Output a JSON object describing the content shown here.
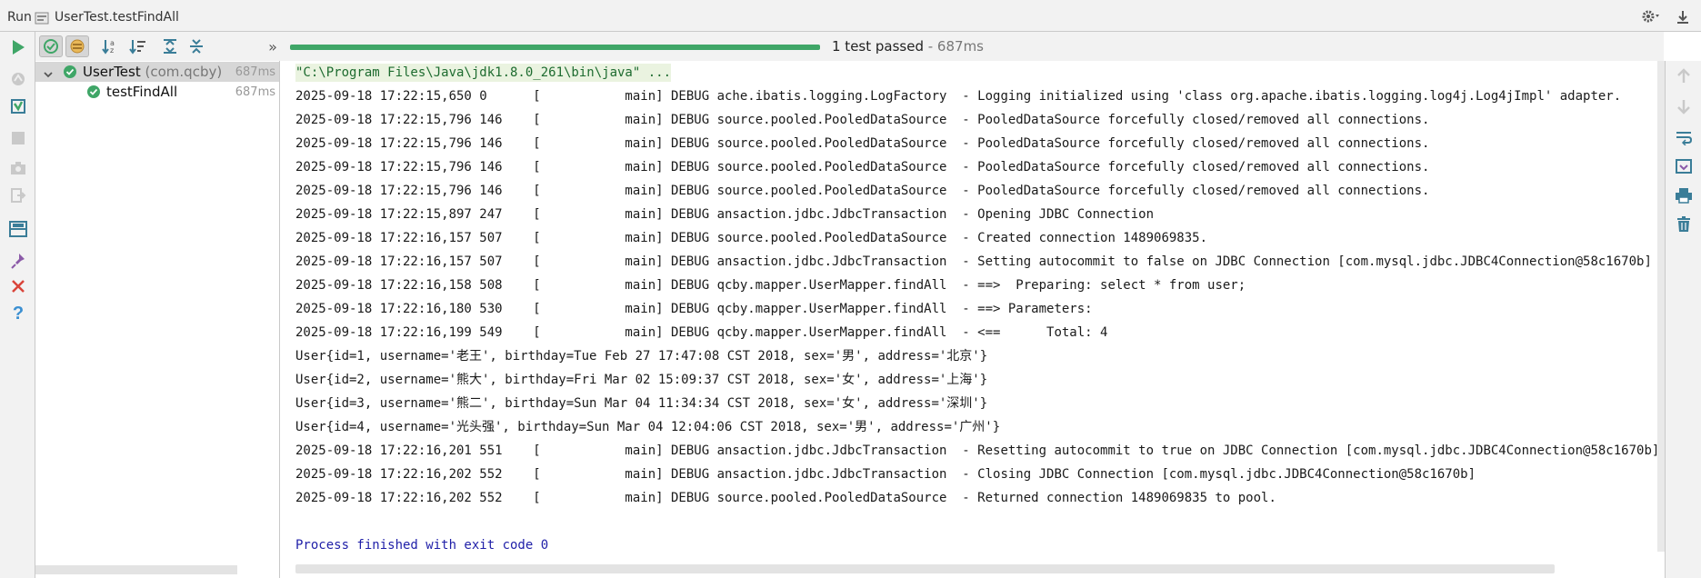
{
  "titlebar": {
    "run_label": "Run",
    "tab_title": "UserTest.testFindAll"
  },
  "toolbar": {
    "status_text": "1 test passed",
    "status_duration": " - 687ms",
    "more_label": "»",
    "progress_percent": 100
  },
  "tree": {
    "items": [
      {
        "name": "UserTest",
        "package": "(com.qcby)",
        "time": "687ms",
        "expanded": true,
        "status": "passed"
      },
      {
        "name": "testFindAll",
        "package": "",
        "time": "687ms",
        "status": "passed"
      }
    ]
  },
  "console": {
    "lines": [
      "\"C:\\Program Files\\Java\\jdk1.8.0_261\\bin\\java\" ...",
      "2025-09-18 17:22:15,650 0      [           main] DEBUG ache.ibatis.logging.LogFactory  - Logging initialized using 'class org.apache.ibatis.logging.log4j.Log4jImpl' adapter.",
      "2025-09-18 17:22:15,796 146    [           main] DEBUG source.pooled.PooledDataSource  - PooledDataSource forcefully closed/removed all connections.",
      "2025-09-18 17:22:15,796 146    [           main] DEBUG source.pooled.PooledDataSource  - PooledDataSource forcefully closed/removed all connections.",
      "2025-09-18 17:22:15,796 146    [           main] DEBUG source.pooled.PooledDataSource  - PooledDataSource forcefully closed/removed all connections.",
      "2025-09-18 17:22:15,796 146    [           main] DEBUG source.pooled.PooledDataSource  - PooledDataSource forcefully closed/removed all connections.",
      "2025-09-18 17:22:15,897 247    [           main] DEBUG ansaction.jdbc.JdbcTransaction  - Opening JDBC Connection",
      "2025-09-18 17:22:16,157 507    [           main] DEBUG source.pooled.PooledDataSource  - Created connection 1489069835.",
      "2025-09-18 17:22:16,157 507    [           main] DEBUG ansaction.jdbc.JdbcTransaction  - Setting autocommit to false on JDBC Connection [com.mysql.jdbc.JDBC4Connection@58c1670b]",
      "2025-09-18 17:22:16,158 508    [           main] DEBUG qcby.mapper.UserMapper.findAll  - ==>  Preparing: select * from user;",
      "2025-09-18 17:22:16,180 530    [           main] DEBUG qcby.mapper.UserMapper.findAll  - ==> Parameters: ",
      "2025-09-18 17:22:16,199 549    [           main] DEBUG qcby.mapper.UserMapper.findAll  - <==      Total: 4",
      "User{id=1, username='老王', birthday=Tue Feb 27 17:47:08 CST 2018, sex='男', address='北京'}",
      "User{id=2, username='熊大', birthday=Fri Mar 02 15:09:37 CST 2018, sex='女', address='上海'}",
      "User{id=3, username='熊二', birthday=Sun Mar 04 11:34:34 CST 2018, sex='女', address='深圳'}",
      "User{id=4, username='光头强', birthday=Sun Mar 04 12:04:06 CST 2018, sex='男', address='广州'}",
      "2025-09-18 17:22:16,201 551    [           main] DEBUG ansaction.jdbc.JdbcTransaction  - Resetting autocommit to true on JDBC Connection [com.mysql.jdbc.JDBC4Connection@58c1670b]",
      "2025-09-18 17:22:16,202 552    [           main] DEBUG ansaction.jdbc.JdbcTransaction  - Closing JDBC Connection [com.mysql.jdbc.JDBC4Connection@58c1670b]",
      "2025-09-18 17:22:16,202 552    [           main] DEBUG source.pooled.PooledDataSource  - Returned connection 1489069835 to pool.",
      "",
      "Process finished with exit code 0"
    ]
  },
  "colors": {
    "passed_green": "#3fa667",
    "command_text": "#1d6b2f",
    "finished_text": "#1f1fa8"
  }
}
